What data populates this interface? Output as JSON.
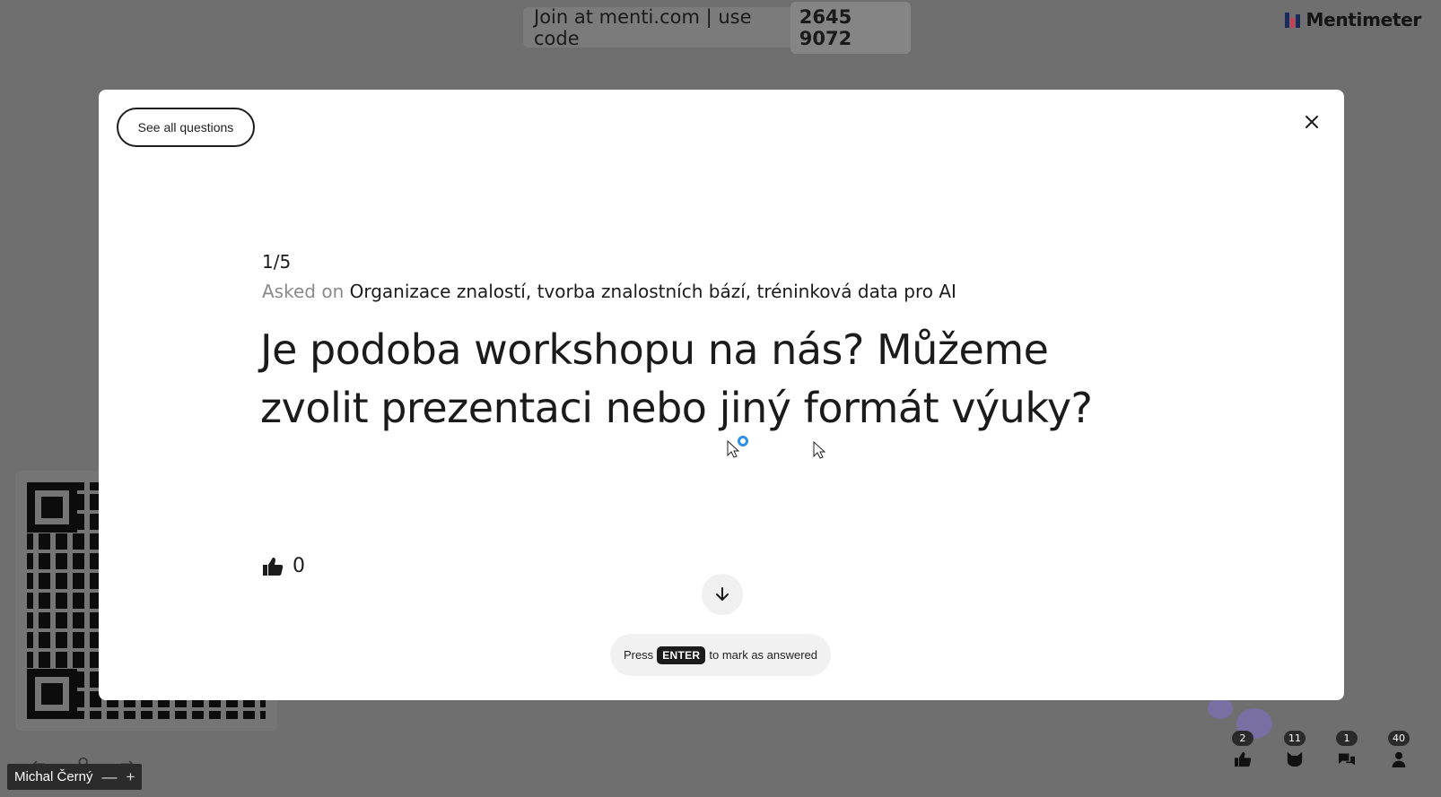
{
  "join": {
    "text": "Join at menti.com | use code",
    "code": "2645 9072"
  },
  "brand": {
    "name": "Mentimeter"
  },
  "modal": {
    "see_all_label": "See all questions",
    "close_icon": "close-icon",
    "counter": "1/5",
    "asked_prefix": "Asked on",
    "asked_session": "Organizace znalostí, tvorba znalostních bází, tréninková data pro AI",
    "question": "Je podoba workshopu na nás? Můžeme zvolit prezentaci nebo jiný formát výuky?",
    "likes": "0",
    "hint_prefix": "Press",
    "hint_key": "ENTER",
    "hint_suffix": "to mark as answered"
  },
  "user": {
    "name": "Michal Černý",
    "minus": "—",
    "plus": "+"
  },
  "reactions": [
    {
      "icon": "thumbs-up-icon",
      "count": "2"
    },
    {
      "icon": "cat-icon",
      "count": "11"
    },
    {
      "icon": "chat-icon",
      "count": "1"
    },
    {
      "icon": "person-icon",
      "count": "40"
    }
  ],
  "colors": {
    "overlay_bg": "#6f6f6f",
    "modal_bg": "#ffffff",
    "text": "#1b1b1b",
    "muted": "#8a8a8a",
    "cursor_ring": "#2f8fea"
  }
}
